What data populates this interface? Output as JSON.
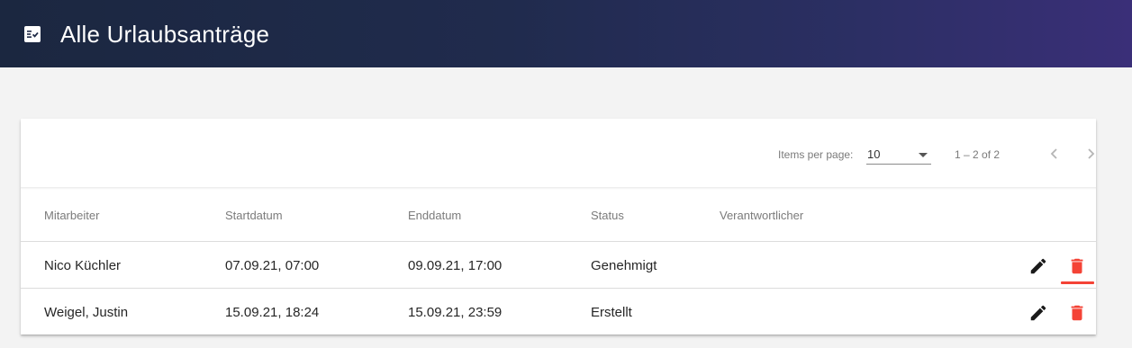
{
  "header": {
    "title": "Alle Urlaubsanträge",
    "icon": "event-list-icon",
    "gradient": [
      "#1b2740",
      "#3a2f78"
    ]
  },
  "paginator": {
    "items_per_page_label": "Items per page:",
    "items_per_page_value": "10",
    "range_label": "1 – 2 of 2"
  },
  "table": {
    "columns": [
      "Mitarbeiter",
      "Startdatum",
      "Enddatum",
      "Status",
      "Verantwortlicher"
    ],
    "rows": [
      {
        "mitarbeiter": "Nico Küchler",
        "startdatum": "07.09.21, 07:00",
        "enddatum": "09.09.21, 17:00",
        "status": "Genehmigt",
        "verantwortlicher": ""
      },
      {
        "mitarbeiter": "Weigel, Justin",
        "startdatum": "15.09.21, 18:24",
        "enddatum": "15.09.21, 23:59",
        "status": "Erstellt",
        "verantwortlicher": ""
      }
    ]
  },
  "colors": {
    "delete": "#f44336",
    "edit": "#1a1a1a"
  }
}
